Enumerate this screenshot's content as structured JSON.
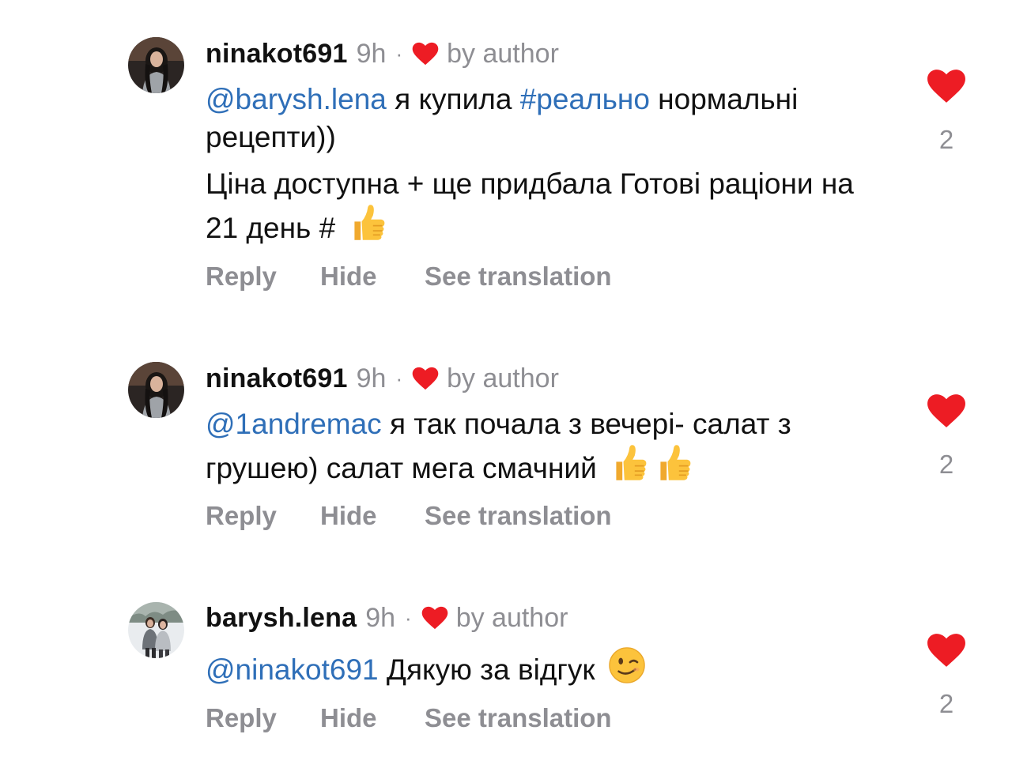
{
  "comments": [
    {
      "username": "ninakot691",
      "time": "9h",
      "separator": "·",
      "author_badge": "by author",
      "paragraphs": [
        [
          {
            "type": "mention",
            "text": "@barysh.lena"
          },
          {
            "type": "text",
            "text": " я купила "
          },
          {
            "type": "hashtag",
            "text": "#реально"
          },
          {
            "type": "text",
            "text": " нормальні рецепти))"
          }
        ],
        [
          {
            "type": "text",
            "text": "Ціна доступна + ще придбала Готові раціони на 21 день # "
          },
          {
            "type": "emoji",
            "icon": "thumbs-up-emoji"
          }
        ]
      ],
      "actions": {
        "reply": "Reply",
        "hide": "Hide",
        "translate": "See translation"
      },
      "like_count": "2"
    },
    {
      "username": "ninakot691",
      "time": "9h",
      "separator": "·",
      "author_badge": "by author",
      "paragraphs": [
        [
          {
            "type": "mention",
            "text": "@1andremac"
          },
          {
            "type": "text",
            "text": " я так почала з вечері- салат з грушею)  салат мега смачний "
          },
          {
            "type": "emoji",
            "icon": "thumbs-up-emoji"
          },
          {
            "type": "emoji",
            "icon": "thumbs-up-emoji"
          }
        ]
      ],
      "actions": {
        "reply": "Reply",
        "hide": "Hide",
        "translate": "See translation"
      },
      "like_count": "2"
    },
    {
      "username": "barysh.lena",
      "time": "9h",
      "separator": "·",
      "author_badge": "by author",
      "paragraphs": [
        [
          {
            "type": "mention",
            "text": "@ninakot691"
          },
          {
            "type": "text",
            "text": " Дякую за відгук "
          },
          {
            "type": "emoji",
            "icon": "winking-face-emoji"
          }
        ]
      ],
      "actions": {
        "reply": "Reply",
        "hide": "Hide",
        "translate": "See translation"
      },
      "like_count": "2"
    }
  ],
  "colors": {
    "heart": "#ed1c24",
    "link": "#2f6fb8",
    "muted": "#8e8e93",
    "text": "#111111"
  }
}
